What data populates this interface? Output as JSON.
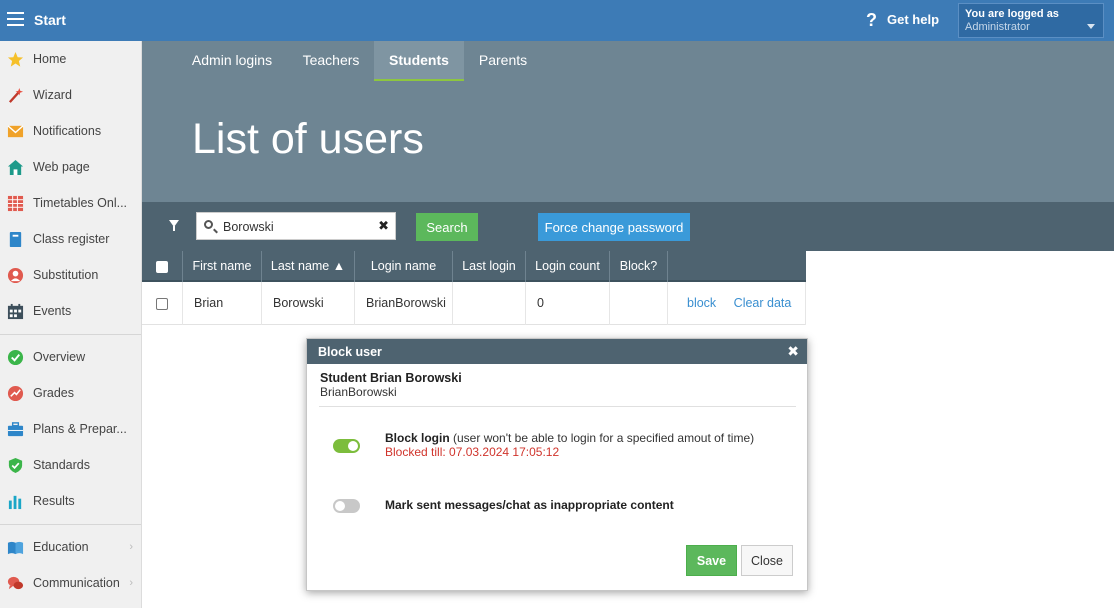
{
  "topbar": {
    "start_label": "Start",
    "help_label": "Get help",
    "user_box_line1": "You are logged as",
    "user_box_line2": "Administrator"
  },
  "sidebar": {
    "items": [
      {
        "label": "Home",
        "icon": "star-icon"
      },
      {
        "label": "Wizard",
        "icon": "wand-icon"
      },
      {
        "label": "Notifications",
        "icon": "envelope-icon"
      },
      {
        "label": "Web page",
        "icon": "house-icon"
      },
      {
        "label": "Timetables Onl...",
        "icon": "timetable-icon"
      },
      {
        "label": "Class register",
        "icon": "book-icon"
      },
      {
        "label": "Substitution",
        "icon": "person-icon"
      },
      {
        "label": "Events",
        "icon": "calendar-icon"
      },
      {
        "label": "Overview",
        "icon": "check-circle-icon"
      },
      {
        "label": "Grades",
        "icon": "grades-icon"
      },
      {
        "label": "Plans & Prepar...",
        "icon": "briefcase-icon"
      },
      {
        "label": "Standards",
        "icon": "shield-check-icon"
      },
      {
        "label": "Results",
        "icon": "bar-chart-icon"
      },
      {
        "label": "Education",
        "icon": "open-book-icon"
      },
      {
        "label": "Communication",
        "icon": "chat-icon"
      }
    ]
  },
  "header": {
    "tabs": [
      {
        "label": "Admin logins",
        "active": false
      },
      {
        "label": "Teachers",
        "active": false
      },
      {
        "label": "Students",
        "active": true
      },
      {
        "label": "Parents",
        "active": false
      }
    ],
    "title": "List of users"
  },
  "filter": {
    "search_value": "Borowski",
    "search_button": "Search",
    "force_button": "Force change password"
  },
  "table": {
    "columns": [
      "First name",
      "Last name ▲",
      "Login name",
      "Last login",
      "Login count",
      "Block?"
    ],
    "rows": [
      {
        "first_name": "Brian",
        "last_name": "Borowski",
        "login_name": "BrianBorowski",
        "last_login": "",
        "login_count": "0",
        "block": "",
        "action_block": "block",
        "action_clear": "Clear data"
      }
    ]
  },
  "modal": {
    "title": "Block user",
    "student_name": "Student Brian Borowski",
    "login_name": "BrianBorowski",
    "block_login_label": "Block login",
    "block_login_desc": "(user won't be able to login for a specified amout of time)",
    "blocked_till": "Blocked till: 07.03.2024 17:05:12",
    "mark_label": "Mark sent messages/chat as inappropriate content",
    "save_label": "Save",
    "close_label": "Close"
  },
  "colors": {
    "topbar": "#3d7bb6",
    "header_band": "#6e8593",
    "filterbar": "#4e6370",
    "success": "#5cb85c",
    "primary": "#3a9ad9",
    "toggle_on": "#7cbd3c",
    "danger_text": "#d0342c"
  }
}
